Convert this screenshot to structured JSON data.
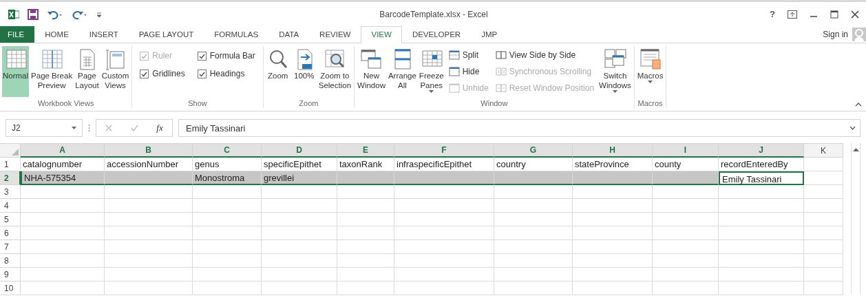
{
  "title_bar": {
    "title": "BarcodeTemplate.xlsx - Excel",
    "help": "?"
  },
  "tabs": [
    {
      "label": "FILE",
      "selected": false,
      "kind": "file"
    },
    {
      "label": "HOME",
      "selected": false,
      "kind": "tab"
    },
    {
      "label": "INSERT",
      "selected": false,
      "kind": "tab"
    },
    {
      "label": "PAGE LAYOUT",
      "selected": false,
      "kind": "tab"
    },
    {
      "label": "FORMULAS",
      "selected": false,
      "kind": "tab"
    },
    {
      "label": "DATA",
      "selected": false,
      "kind": "tab"
    },
    {
      "label": "REVIEW",
      "selected": false,
      "kind": "tab"
    },
    {
      "label": "VIEW",
      "selected": true,
      "kind": "tab"
    },
    {
      "label": "DEVELOPER",
      "selected": false,
      "kind": "tab"
    },
    {
      "label": "JMP",
      "selected": false,
      "kind": "tab"
    }
  ],
  "sign_in": "Sign in",
  "ribbon": [
    {
      "label": "Workbook Views",
      "columns": [
        [
          {
            "kind": "big",
            "label": "Normal",
            "selected": true
          }
        ],
        [
          {
            "kind": "big",
            "label": "Page Break\nPreview",
            "selected": false
          }
        ],
        [
          {
            "kind": "big",
            "label": "Page\nLayout",
            "selected": false
          }
        ],
        [
          {
            "kind": "big",
            "label": "Custom\nViews",
            "selected": false
          }
        ]
      ]
    },
    {
      "label": "Show",
      "columns": [
        [
          {
            "kind": "check",
            "label": "Ruler",
            "checked": true,
            "disabled": true
          },
          {
            "kind": "check",
            "label": "Gridlines",
            "checked": true,
            "disabled": false
          }
        ],
        [
          {
            "kind": "check",
            "label": "Formula Bar",
            "checked": true,
            "disabled": false
          },
          {
            "kind": "check",
            "label": "Headings",
            "checked": true,
            "disabled": false
          }
        ]
      ]
    },
    {
      "label": "Zoom",
      "columns": [
        [
          {
            "kind": "big",
            "label": "Zoom"
          }
        ],
        [
          {
            "kind": "big",
            "label": "100%"
          }
        ],
        [
          {
            "kind": "big",
            "label": "Zoom to\nSelection"
          }
        ]
      ]
    },
    {
      "label": "Window",
      "columns": [
        [
          {
            "kind": "big",
            "label": "New\nWindow"
          }
        ],
        [
          {
            "kind": "big",
            "label": "Arrange\nAll"
          }
        ],
        [
          {
            "kind": "big",
            "label": "Freeze\nPanes",
            "has_menu": true
          }
        ],
        [
          {
            "kind": "small",
            "label": "Split",
            "disabled": false
          },
          {
            "kind": "small",
            "label": "Hide",
            "disabled": false
          },
          {
            "kind": "small",
            "label": "Unhide",
            "disabled": true
          }
        ],
        [
          {
            "kind": "small",
            "label": "View Side by Side",
            "disabled": false
          },
          {
            "kind": "small",
            "label": "Synchronous Scrolling",
            "disabled": true
          },
          {
            "kind": "small",
            "label": "Reset Window Position",
            "disabled": true
          }
        ],
        [
          {
            "kind": "big",
            "label": "Switch\nWindows",
            "has_menu": true
          }
        ]
      ]
    },
    {
      "label": "Macros",
      "columns": [
        [
          {
            "kind": "big",
            "label": "Macros",
            "has_menu": true
          }
        ]
      ]
    }
  ],
  "formula_bar": {
    "name_box": "J2",
    "function_label": "fx",
    "value": "Emily Tassinari"
  },
  "grid": {
    "columns": [
      {
        "letter": "A",
        "selected": true
      },
      {
        "letter": "B",
        "selected": true
      },
      {
        "letter": "C",
        "selected": true
      },
      {
        "letter": "D",
        "selected": true
      },
      {
        "letter": "E",
        "selected": true
      },
      {
        "letter": "F",
        "selected": true
      },
      {
        "letter": "G",
        "selected": true
      },
      {
        "letter": "H",
        "selected": true
      },
      {
        "letter": "I",
        "selected": true
      },
      {
        "letter": "J",
        "selected": true
      },
      {
        "letter": "K",
        "selected": false
      }
    ],
    "rows": [
      {
        "number": "1",
        "selected": false,
        "cells": [
          {
            "text": "catalognumber"
          },
          {
            "text": "accessionNumber"
          },
          {
            "text": "genus"
          },
          {
            "text": "specificEpithet"
          },
          {
            "text": "taxonRank"
          },
          {
            "text": "infraspecificEpithet"
          },
          {
            "text": "country"
          },
          {
            "text": "stateProvince"
          },
          {
            "text": "county"
          },
          {
            "text": "recordEnteredBy"
          }
        ]
      },
      {
        "number": "2",
        "selected": true,
        "cells": [
          {
            "text": "NHA-575354",
            "active": false
          },
          {
            "active": false
          },
          {
            "text": "Monostroma",
            "active": false
          },
          {
            "text": "grevillei",
            "active": false
          },
          {
            "active": false
          },
          {
            "active": false
          },
          {
            "active": false
          },
          {
            "active": false
          },
          {
            "active": false
          },
          {
            "text": "Emily Tassinari",
            "active": true
          }
        ]
      },
      {
        "number": "3",
        "selected": false
      },
      {
        "number": "4",
        "selected": false
      },
      {
        "number": "5",
        "selected": false
      },
      {
        "number": "6",
        "selected": false
      },
      {
        "number": "7",
        "selected": false
      },
      {
        "number": "8",
        "selected": false
      },
      {
        "number": "9",
        "selected": false
      },
      {
        "number": "10",
        "selected": false
      }
    ]
  }
}
